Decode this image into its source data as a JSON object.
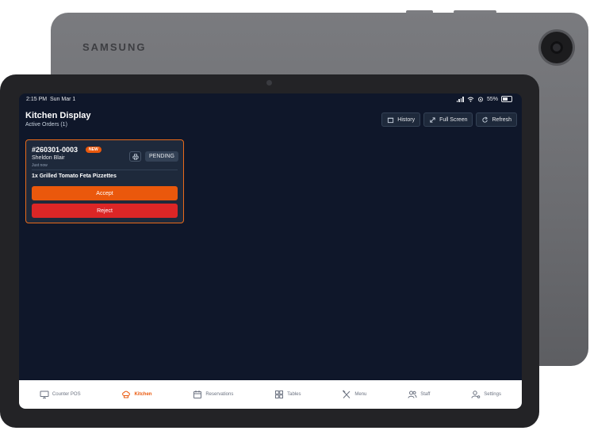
{
  "device": {
    "brand": "SAMSUNG"
  },
  "status_bar": {
    "time": "2:15 PM",
    "date": "Sun Mar 1",
    "battery": "55%"
  },
  "header": {
    "title": "Kitchen Display",
    "subtitle": "Active Orders (1)",
    "buttons": [
      {
        "label": "History",
        "icon": "history-icon"
      },
      {
        "label": "Full Screen",
        "icon": "expand-icon"
      },
      {
        "label": "Refresh",
        "icon": "refresh-icon"
      }
    ]
  },
  "order": {
    "id": "#260301-0003",
    "badge": "NEW",
    "customer": "Sheldon Blair",
    "time": "Just now",
    "status": "PENDING",
    "item": "1x Grilled Tomato Feta Pizzettes",
    "accept_label": "Accept",
    "reject_label": "Reject"
  },
  "nav": [
    {
      "label": "Counter POS",
      "icon": "monitor-icon",
      "active": false
    },
    {
      "label": "Kitchen",
      "icon": "chef-hat-icon",
      "active": true
    },
    {
      "label": "Reservations",
      "icon": "calendar-icon",
      "active": false
    },
    {
      "label": "Tables",
      "icon": "grid-icon",
      "active": false
    },
    {
      "label": "Menu",
      "icon": "utensils-icon",
      "active": false
    },
    {
      "label": "Staff",
      "icon": "users-icon",
      "active": false
    },
    {
      "label": "Settings",
      "icon": "user-cog-icon",
      "active": false
    }
  ],
  "colors": {
    "accent": "#ea580c",
    "danger": "#dc2626",
    "background": "#0f172a",
    "card": "#1e293b"
  }
}
